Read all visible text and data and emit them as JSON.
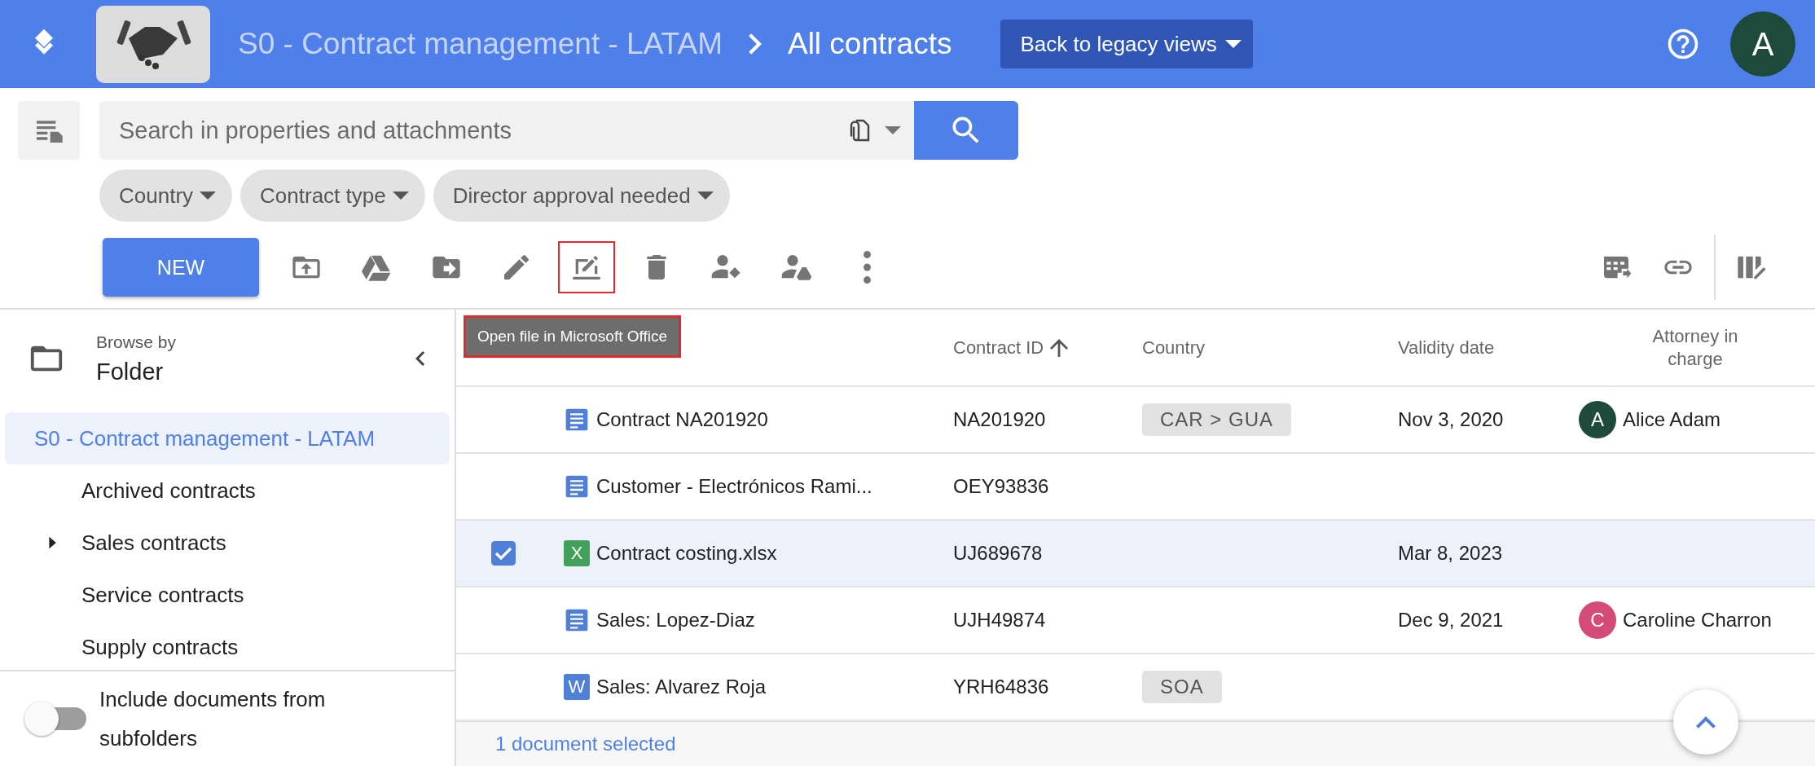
{
  "header": {
    "breadcrumb": [
      {
        "label": "S0 - Contract management - LATAM",
        "current": false
      },
      {
        "label": "All contracts",
        "current": true
      }
    ],
    "legacy_button": "Back to legacy views",
    "avatar": "A"
  },
  "search": {
    "placeholder": "Search in properties and attachments"
  },
  "filters": [
    "Country",
    "Contract type",
    "Director approval needed"
  ],
  "toolbar": {
    "new_button": "NEW",
    "tools": [
      {
        "kind": "upload-folder",
        "highlighted": false
      },
      {
        "kind": "drive",
        "highlighted": false
      },
      {
        "kind": "move-folder",
        "highlighted": false
      },
      {
        "kind": "pencil",
        "highlighted": false
      },
      {
        "kind": "edit-laptop",
        "highlighted": true
      },
      {
        "kind": "trash",
        "highlighted": false
      },
      {
        "kind": "person-diamond",
        "highlighted": false
      },
      {
        "kind": "person-drive",
        "highlighted": false
      },
      {
        "kind": "more",
        "highlighted": false
      }
    ],
    "right_tools": [
      {
        "kind": "table-export"
      },
      {
        "kind": "link"
      },
      {
        "kind": "columns-edit"
      }
    ]
  },
  "tooltip": "Open file in Microsoft Office",
  "sidebar": {
    "browse_label": "Browse by",
    "browse_mode": "Folder",
    "items": [
      {
        "label": "S0 - Contract management - LATAM",
        "selected": true,
        "has_children": false,
        "children": [
          {
            "label": "Archived contracts",
            "selected": false,
            "has_children": false
          },
          {
            "label": "Sales contracts",
            "selected": false,
            "has_children": true
          },
          {
            "label": "Service contracts",
            "selected": false,
            "has_children": false
          },
          {
            "label": "Supply contracts",
            "selected": false,
            "has_children": false
          }
        ]
      }
    ],
    "toggle": {
      "label": "Include documents from subfolders",
      "on": false
    }
  },
  "table": {
    "columns": [
      {
        "label": "Contract ID",
        "sort_ascending": true
      },
      {
        "label": "Country"
      },
      {
        "label": "Validity date"
      },
      {
        "label": "Attorney in charge"
      }
    ],
    "rows": [
      {
        "selected": false,
        "file": {
          "kind": "doc"
        },
        "title": "Contract NA201920",
        "contract_id": "NA201920",
        "country": "CAR > GUA",
        "validity_date": "Nov 3, 2020",
        "attorney": {
          "initial": "A",
          "name": "Alice Adam",
          "color": "#1d4a3b"
        }
      },
      {
        "selected": false,
        "file": {
          "kind": "doc"
        },
        "title": "Customer - Electrónicos Rami...",
        "contract_id": "OEY93836"
      },
      {
        "selected": true,
        "file": {
          "kind": "letter",
          "letter": "X",
          "color": "#43a05a"
        },
        "title": "Contract costing.xlsx",
        "contract_id": "UJ689678",
        "validity_date": "Mar 8, 2023"
      },
      {
        "selected": false,
        "file": {
          "kind": "doc"
        },
        "title": "Sales: Lopez-Diaz",
        "contract_id": "UJH49874",
        "validity_date": "Dec 9, 2021",
        "attorney": {
          "initial": "C",
          "name": "Caroline Charron",
          "color": "#d54b77"
        }
      },
      {
        "selected": false,
        "file": {
          "kind": "letter",
          "letter": "W",
          "color": "#4f7fd6"
        },
        "title": "Sales: Alvarez Roja",
        "contract_id": "YRH64836",
        "country": "SOA"
      }
    ]
  },
  "footer": {
    "selection": "1 document selected"
  }
}
